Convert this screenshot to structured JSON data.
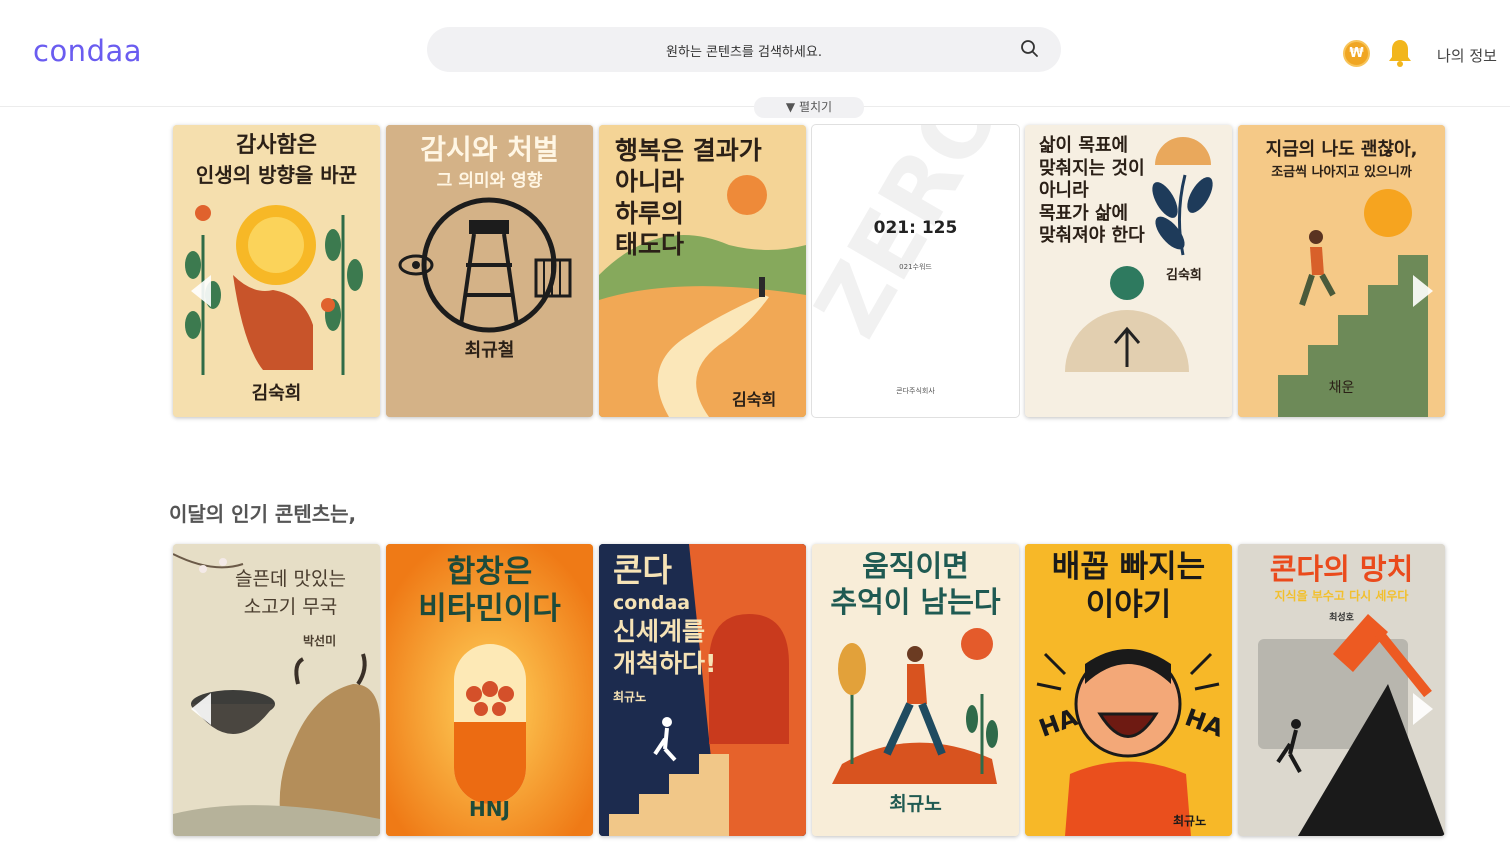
{
  "header": {
    "logo": "condaa",
    "search_placeholder": "원하는 콘텐츠를 검색하세요.",
    "coin_symbol": "₩",
    "my_info": "나의 정보",
    "expand_label": "▼ 펼치기"
  },
  "row1": [
    {
      "title1": "감사함은",
      "title2": "인생의 방향을 바꾼",
      "author": "김숙희"
    },
    {
      "title": "감시와 처벌",
      "subtitle": "그 의미와 영향",
      "author": "최규철"
    },
    {
      "lines": [
        "행복은 결과가",
        "아니라",
        "하루의",
        "태도다"
      ],
      "author": "김숙희"
    },
    {
      "title": "021: 125",
      "subtitle": "021수워드",
      "publisher": "콘다주식회사",
      "watermark": "ZERO"
    },
    {
      "lines": [
        "삶이 목표에",
        "맞춰지는 것이",
        "아니라",
        "목표가 삶에",
        "맞춰져야 한다"
      ],
      "author": "김숙희"
    },
    {
      "title1": "지금의 나도 괜찮아,",
      "title2": "조금씩 나아지고 있으니까",
      "author": "채운"
    }
  ],
  "section_title": "이달의 인기 콘텐츠는,",
  "row2": [
    {
      "title1": "슬픈데 맛있는",
      "title2": "소고기 무국",
      "author": "박선미"
    },
    {
      "title1": "합창은",
      "title2": "비타민이다",
      "author": "HNJ"
    },
    {
      "title1": "콘다",
      "brand": "condaa",
      "title2": "신세계를",
      "title3": "개척하다!",
      "author": "최규노"
    },
    {
      "title1": "움직이면",
      "title2": "추억이 남는다",
      "author": "최규노"
    },
    {
      "title1": "배꼽 빠지는",
      "title2": "이야기",
      "ha": "HA",
      "author": "최규노"
    },
    {
      "title": "콘다의 망치",
      "subtitle": "지식을 부수고 다시 세우다",
      "author": "최성호"
    }
  ],
  "colors": {
    "brand": "#6a5cf0",
    "coin": "#f0a623",
    "bell": "#f2b61c"
  }
}
